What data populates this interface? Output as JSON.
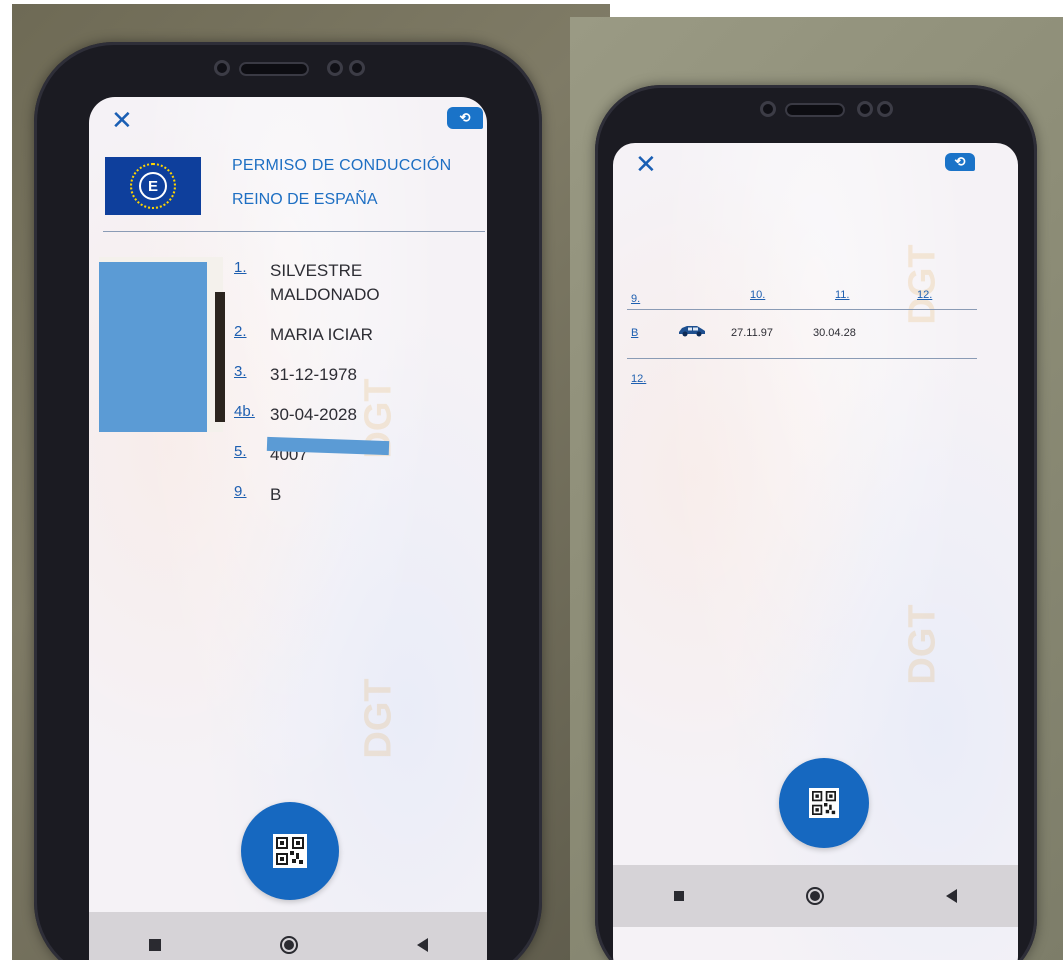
{
  "left_screen": {
    "header": {
      "flag_letter": "E",
      "title": "PERMISO DE CONDUCCIÓN",
      "subtitle": "REINO DE ESPAÑA"
    },
    "fields": [
      {
        "num": "1.",
        "value": "SILVESTRE"
      },
      {
        "num": "",
        "value": "MALDONADO"
      },
      {
        "num": "2.",
        "value": "MARIA ICIAR"
      },
      {
        "num": "3.",
        "value": "31-12-1978"
      },
      {
        "num": "4b.",
        "value": "30-04-2028"
      },
      {
        "num": "5.",
        "value": "4007"
      },
      {
        "num": "9.",
        "value": "B"
      }
    ]
  },
  "right_screen": {
    "table_headers": [
      "9.",
      "10.",
      "11.",
      "12."
    ],
    "row": {
      "category": "B",
      "vehicle_icon": "car-icon",
      "date_from": "27.11.97",
      "date_to": "30.04.28"
    },
    "footer_label": "12."
  },
  "icons": {
    "close": "✕",
    "flip": "⟲"
  },
  "colors": {
    "accent": "#1668c0",
    "eu_blue": "#0e3f9c",
    "redaction": "#5b9bd5"
  }
}
